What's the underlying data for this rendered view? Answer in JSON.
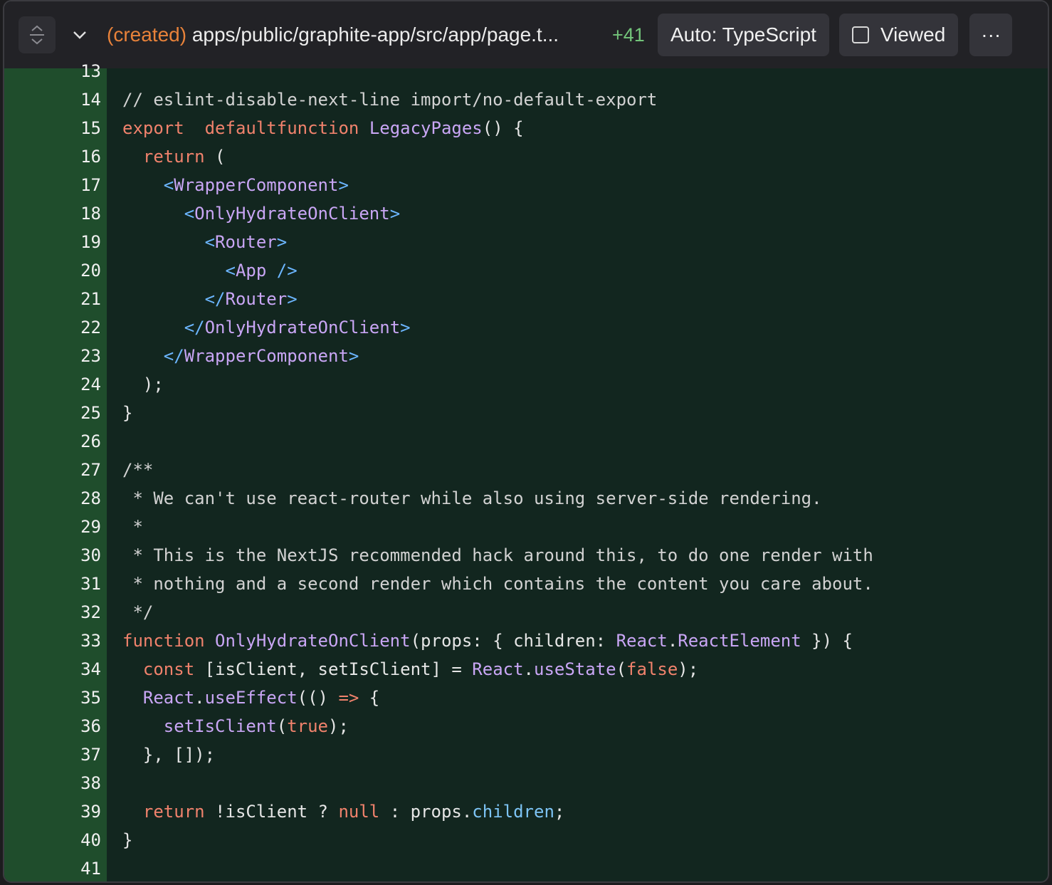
{
  "header": {
    "status": "(created)",
    "path": "apps/public/graphite-app/src/app/page.t...",
    "added_count": "+41",
    "language_button": "Auto: TypeScript",
    "viewed_label": "Viewed",
    "more_label": "···"
  },
  "icons": {
    "collapse": "unfold-icon",
    "expand": "chevron-down-icon",
    "viewed": "checkbox-icon"
  },
  "colors": {
    "added_gutter": "#1f4d2c",
    "added_bg": "#12261f",
    "keyword": "#f0826c",
    "function": "#c9a6f5",
    "status_created": "#e8823a",
    "added_count": "#73c47a"
  },
  "code": {
    "line_numbers": [
      "13",
      "14",
      "15",
      "16",
      "17",
      "18",
      "19",
      "20",
      "21",
      "22",
      "23",
      "24",
      "25",
      "26",
      "27",
      "28",
      "29",
      "30",
      "31",
      "32",
      "33",
      "34",
      "35",
      "36",
      "37",
      "38",
      "39",
      "40",
      "41"
    ],
    "lines": [
      [],
      [
        [
          "c-cm",
          "// eslint-disable-next-line import/no-default-export"
        ]
      ],
      [
        [
          "c-kw",
          "export"
        ],
        [
          "",
          "  "
        ],
        [
          "c-kw",
          "default"
        ],
        [
          "",
          ""
        ],
        [
          "c-kw",
          "function"
        ],
        [
          "",
          " "
        ],
        [
          "c-fn",
          "LegacyPages"
        ],
        [
          "",
          "() {"
        ]
      ],
      [
        [
          "",
          "  "
        ],
        [
          "c-kw",
          "return"
        ],
        [
          "",
          " ("
        ]
      ],
      [
        [
          "",
          "    "
        ],
        [
          "c-br",
          "<"
        ],
        [
          "c-tag",
          "WrapperComponent"
        ],
        [
          "c-br",
          ">"
        ]
      ],
      [
        [
          "",
          "      "
        ],
        [
          "c-br",
          "<"
        ],
        [
          "c-tag",
          "OnlyHydrateOnClient"
        ],
        [
          "c-br",
          ">"
        ]
      ],
      [
        [
          "",
          "        "
        ],
        [
          "c-br",
          "<"
        ],
        [
          "c-tag",
          "Router"
        ],
        [
          "c-br",
          ">"
        ]
      ],
      [
        [
          "",
          "          "
        ],
        [
          "c-br",
          "<"
        ],
        [
          "c-tag",
          "App"
        ],
        [
          "c-br",
          " />"
        ]
      ],
      [
        [
          "",
          "        "
        ],
        [
          "c-br",
          "</"
        ],
        [
          "c-tag",
          "Router"
        ],
        [
          "c-br",
          ">"
        ]
      ],
      [
        [
          "",
          "      "
        ],
        [
          "c-br",
          "</"
        ],
        [
          "c-tag",
          "OnlyHydrateOnClient"
        ],
        [
          "c-br",
          ">"
        ]
      ],
      [
        [
          "",
          "    "
        ],
        [
          "c-br",
          "</"
        ],
        [
          "c-tag",
          "WrapperComponent"
        ],
        [
          "c-br",
          ">"
        ]
      ],
      [
        [
          "",
          "  );"
        ]
      ],
      [
        [
          "",
          "}"
        ]
      ],
      [],
      [
        [
          "c-cm",
          "/**"
        ]
      ],
      [
        [
          "c-cm",
          " * We can't use react-router while also using server-side rendering."
        ]
      ],
      [
        [
          "c-cm",
          " *"
        ]
      ],
      [
        [
          "c-cm",
          " * This is the NextJS recommended hack around this, to do one render with"
        ]
      ],
      [
        [
          "c-cm",
          " * nothing and a second render which contains the content you care about."
        ]
      ],
      [
        [
          "c-cm",
          " */"
        ]
      ],
      [
        [
          "c-kw",
          "function"
        ],
        [
          "",
          " "
        ],
        [
          "c-fn",
          "OnlyHydrateOnClient"
        ],
        [
          "",
          "(props: { children: "
        ],
        [
          "c-ty",
          "React"
        ],
        [
          "",
          "."
        ],
        [
          "c-ty",
          "ReactElement"
        ],
        [
          "",
          " }) {"
        ]
      ],
      [
        [
          "",
          "  "
        ],
        [
          "c-kw",
          "const"
        ],
        [
          "",
          " [isClient, setIsClient] = "
        ],
        [
          "c-ty",
          "React"
        ],
        [
          "",
          "."
        ],
        [
          "c-fn",
          "useState"
        ],
        [
          "",
          "("
        ],
        [
          "c-kw",
          "false"
        ],
        [
          "",
          ");"
        ]
      ],
      [
        [
          "",
          "  "
        ],
        [
          "c-ty",
          "React"
        ],
        [
          "",
          "."
        ],
        [
          "c-fn",
          "useEffect"
        ],
        [
          "",
          "(() "
        ],
        [
          "c-kw",
          "=>"
        ],
        [
          "",
          " {"
        ]
      ],
      [
        [
          "",
          "    "
        ],
        [
          "c-fn",
          "setIsClient"
        ],
        [
          "",
          "("
        ],
        [
          "c-kw",
          "true"
        ],
        [
          "",
          ");"
        ]
      ],
      [
        [
          "",
          "  }, []);"
        ]
      ],
      [],
      [
        [
          "",
          "  "
        ],
        [
          "c-kw",
          "return"
        ],
        [
          "",
          " !isClient ? "
        ],
        [
          "c-kw",
          "null"
        ],
        [
          "",
          " : props."
        ],
        [
          "c-pr",
          "children"
        ],
        [
          "",
          ";"
        ]
      ],
      [
        [
          "",
          "}"
        ]
      ],
      []
    ]
  }
}
